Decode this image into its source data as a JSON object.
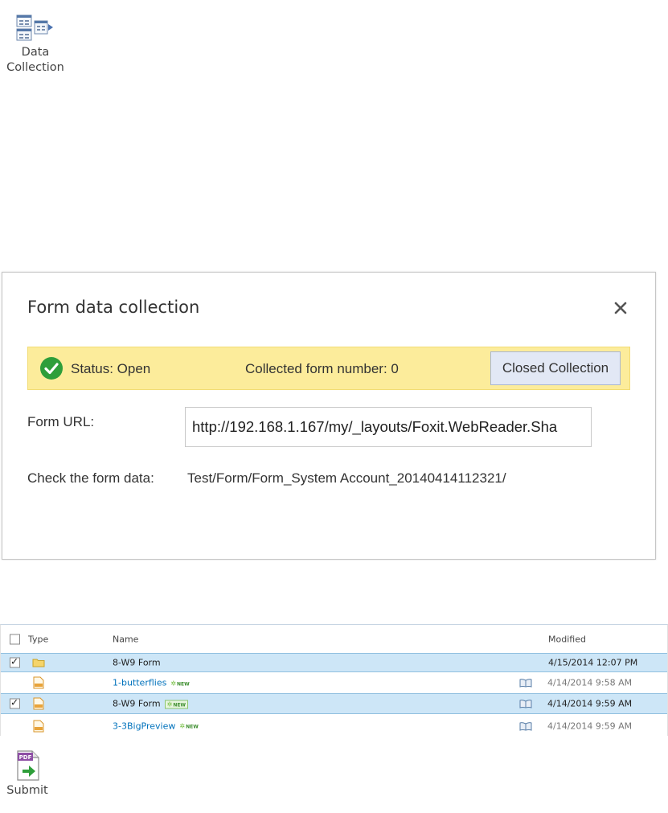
{
  "ribbon": {
    "data_collection_label_line1": "Data",
    "data_collection_label_line2": "Collection",
    "data_collection_icon": "data-collection-icon"
  },
  "dialog": {
    "title": "Form data collection",
    "close_icon": "close-icon",
    "status": {
      "icon": "check-circle-icon",
      "status_text": "Status: Open",
      "collected_text": "Collected form number: 0",
      "button_label": "Closed Collection",
      "bar_color": "#fcec9b",
      "check_color": "#2e9e3a"
    },
    "form_url_label": "Form URL:",
    "form_url_value": "http://192.168.1.167/my/_layouts/Foxit.WebReader.Sha",
    "check_label": "Check the form data:",
    "check_path": "Test/Form/Form_System Account_20140414112321/"
  },
  "list": {
    "columns": {
      "type": "Type",
      "name": "Name",
      "modified": "Modified"
    },
    "new_badge": "NEW",
    "rows": [
      {
        "name": "8-W9 Form",
        "kind": "folder",
        "checked": true,
        "modified": "4/15/2014 12:07 PM",
        "is_new": false,
        "selected": true
      },
      {
        "name": "1-butterflies",
        "kind": "pdf",
        "checked": false,
        "modified": "4/14/2014 9:58 AM",
        "is_new": true,
        "selected": false
      },
      {
        "name": "8-W9 Form",
        "kind": "pdf",
        "checked": true,
        "modified": "4/14/2014 9:59 AM",
        "is_new": true,
        "selected": true
      },
      {
        "name": "3-3BigPreview",
        "kind": "pdf",
        "checked": false,
        "modified": "4/14/2014 9:59 AM",
        "is_new": true,
        "selected": false
      }
    ],
    "selected_color": "#cde6f7",
    "link_color": "#0072bc"
  },
  "submit": {
    "label": "Submit",
    "icon": "pdf-submit-icon"
  }
}
